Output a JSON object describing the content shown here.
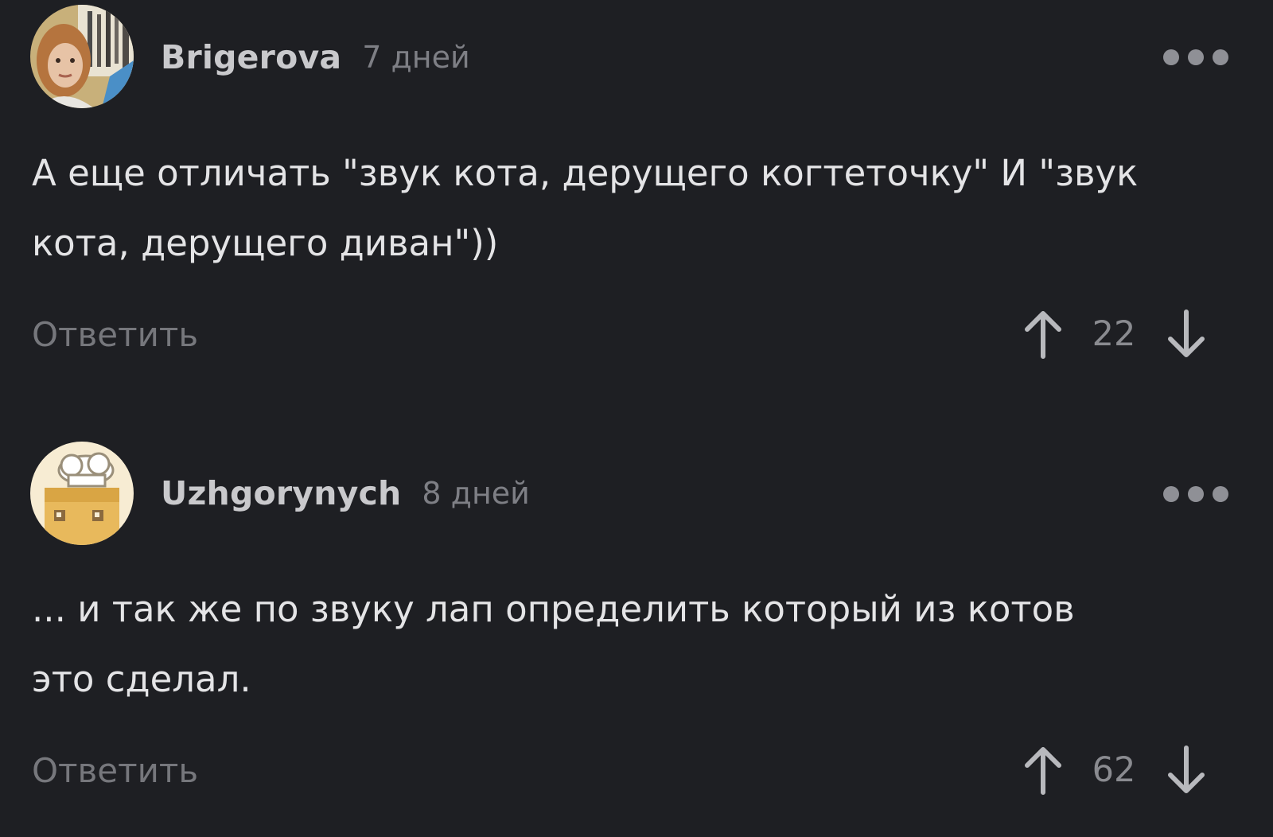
{
  "comments": [
    {
      "author": "Brigerova",
      "time": "7 дней",
      "text_lines": [
        "А еще отличать \"звук кота, дерущего когтеточку\" И \"звук",
        "кота, дерущего диван\"))"
      ],
      "reply_label": "Ответить",
      "votes": "22"
    },
    {
      "author": "Uzhgorynych",
      "time": "8 дней",
      "text_lines": [
        "... и так же по звуку лап определить который из котов",
        "это сделал."
      ],
      "reply_label": "Ответить",
      "votes": "62"
    }
  ],
  "colors": {
    "background": "#1e1f23",
    "text": "#e4e4e6",
    "author": "#c9c9cc",
    "muted": "#76777c",
    "dots": "#8f9096"
  },
  "icons": {
    "more": "more-dots-icon",
    "upvote": "arrow-up-icon",
    "downvote": "arrow-down-icon"
  }
}
